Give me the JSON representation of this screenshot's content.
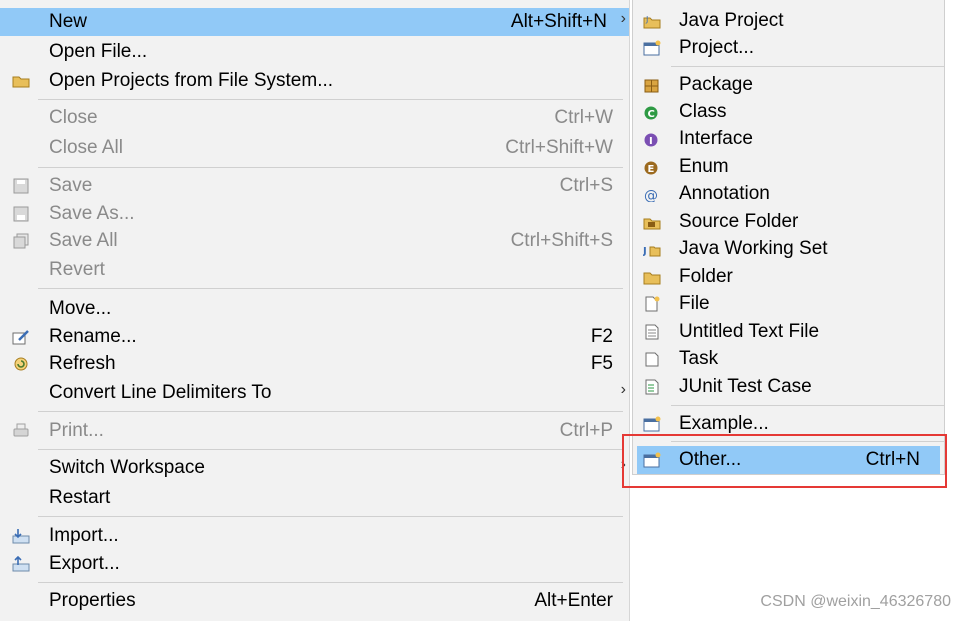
{
  "file_menu": {
    "items": [
      {
        "label": "New",
        "accel": "Alt+Shift+N",
        "submenu": true,
        "highlight": true,
        "icon": ""
      },
      {
        "label": "Open File...",
        "icon": ""
      },
      {
        "label": "Open Projects from File System...",
        "icon": "folder-open-icon"
      },
      {
        "label": "Close",
        "accel": "Ctrl+W",
        "disabled": true
      },
      {
        "label": "Close All",
        "accel": "Ctrl+Shift+W",
        "disabled": true
      },
      {
        "label": "Save",
        "accel": "Ctrl+S",
        "disabled": true,
        "icon": "save-icon"
      },
      {
        "label": "Save As...",
        "disabled": true,
        "icon": "save-as-icon"
      },
      {
        "label": "Save All",
        "accel": "Ctrl+Shift+S",
        "disabled": true,
        "icon": "save-all-icon"
      },
      {
        "label": "Revert",
        "disabled": true
      },
      {
        "label": "Move..."
      },
      {
        "label": "Rename...",
        "accel": "F2",
        "icon": "rename-icon"
      },
      {
        "label": "Refresh",
        "accel": "F5",
        "icon": "refresh-icon"
      },
      {
        "label": "Convert Line Delimiters To",
        "submenu": true
      },
      {
        "label": "Print...",
        "accel": "Ctrl+P",
        "disabled": true,
        "icon": "print-icon"
      },
      {
        "label": "Switch Workspace",
        "submenu": true
      },
      {
        "label": "Restart"
      },
      {
        "label": "Import...",
        "icon": "import-icon"
      },
      {
        "label": "Export...",
        "icon": "export-icon"
      },
      {
        "label": "Properties",
        "accel": "Alt+Enter"
      }
    ]
  },
  "new_submenu": {
    "items": [
      {
        "label": "Java Project",
        "icon": "java-project-icon"
      },
      {
        "label": "Project...",
        "icon": "project-icon"
      },
      {
        "label": "Package",
        "icon": "package-icon"
      },
      {
        "label": "Class",
        "icon": "class-icon"
      },
      {
        "label": "Interface",
        "icon": "interface-icon"
      },
      {
        "label": "Enum",
        "icon": "enum-icon"
      },
      {
        "label": "Annotation",
        "icon": "annotation-icon"
      },
      {
        "label": "Source Folder",
        "icon": "source-folder-icon"
      },
      {
        "label": "Java Working Set",
        "icon": "working-set-icon"
      },
      {
        "label": "Folder",
        "icon": "folder-icon"
      },
      {
        "label": "File",
        "icon": "file-icon"
      },
      {
        "label": "Untitled Text File",
        "icon": "text-file-icon"
      },
      {
        "label": "Task",
        "icon": "task-icon"
      },
      {
        "label": "JUnit Test Case",
        "icon": "junit-icon"
      },
      {
        "label": "Example...",
        "icon": "example-icon"
      },
      {
        "label": "Other...",
        "accel": "Ctrl+N",
        "highlight": true,
        "icon": "other-wizard-icon"
      }
    ]
  },
  "colors": {
    "highlight": "#91c9f7",
    "callout": "#e53935",
    "menu_bg": "#f2f2f2"
  },
  "watermark": "CSDN @weixin_46326780",
  "arrow_glyph": "›"
}
